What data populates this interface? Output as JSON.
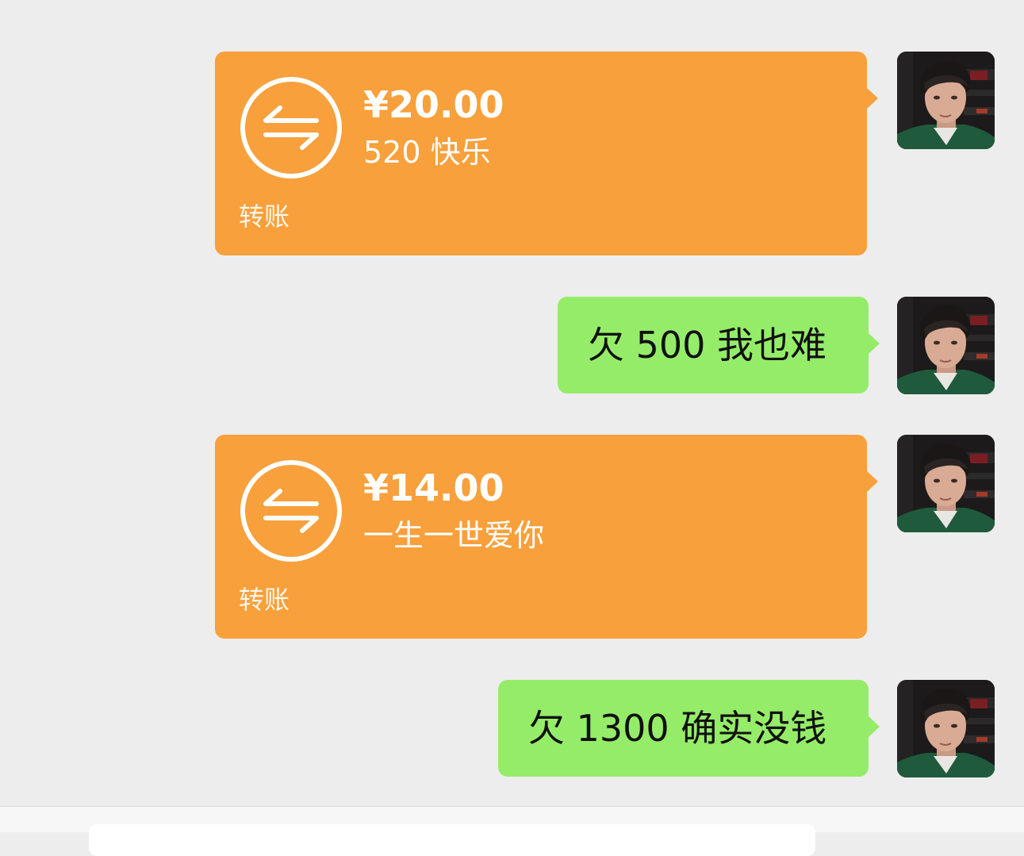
{
  "messages": [
    {
      "kind": "transfer",
      "amount": "¥20.00",
      "note": "520 快乐",
      "type_label": "转账"
    },
    {
      "kind": "text",
      "text": "欠 500 我也难"
    },
    {
      "kind": "transfer",
      "amount": "¥14.00",
      "note": "一生一世爱你",
      "type_label": "转账"
    },
    {
      "kind": "text",
      "text": "欠 1300 确实没钱"
    }
  ],
  "colors": {
    "background": "#ededed",
    "transfer_bubble": "#f8a03b",
    "text_bubble": "#95ec69"
  },
  "icons": {
    "transfer": "transfer-arrows-icon",
    "avatar": "user-avatar"
  }
}
